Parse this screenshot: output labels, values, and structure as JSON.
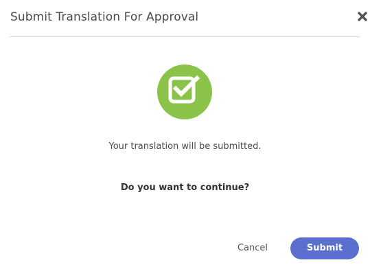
{
  "dialog": {
    "title": "Submit Translation For Approval",
    "close_icon": "close-icon",
    "status_icon": "checkbox-checked-icon",
    "message": "Your translation will be submitted.",
    "question": "Do you want to continue?",
    "cancel_label": "Cancel",
    "submit_label": "Submit"
  },
  "colors": {
    "success": "#8bc34a",
    "primary": "#5a6fd0",
    "text": "#4a4a4a",
    "divider": "#dcdcdc"
  }
}
